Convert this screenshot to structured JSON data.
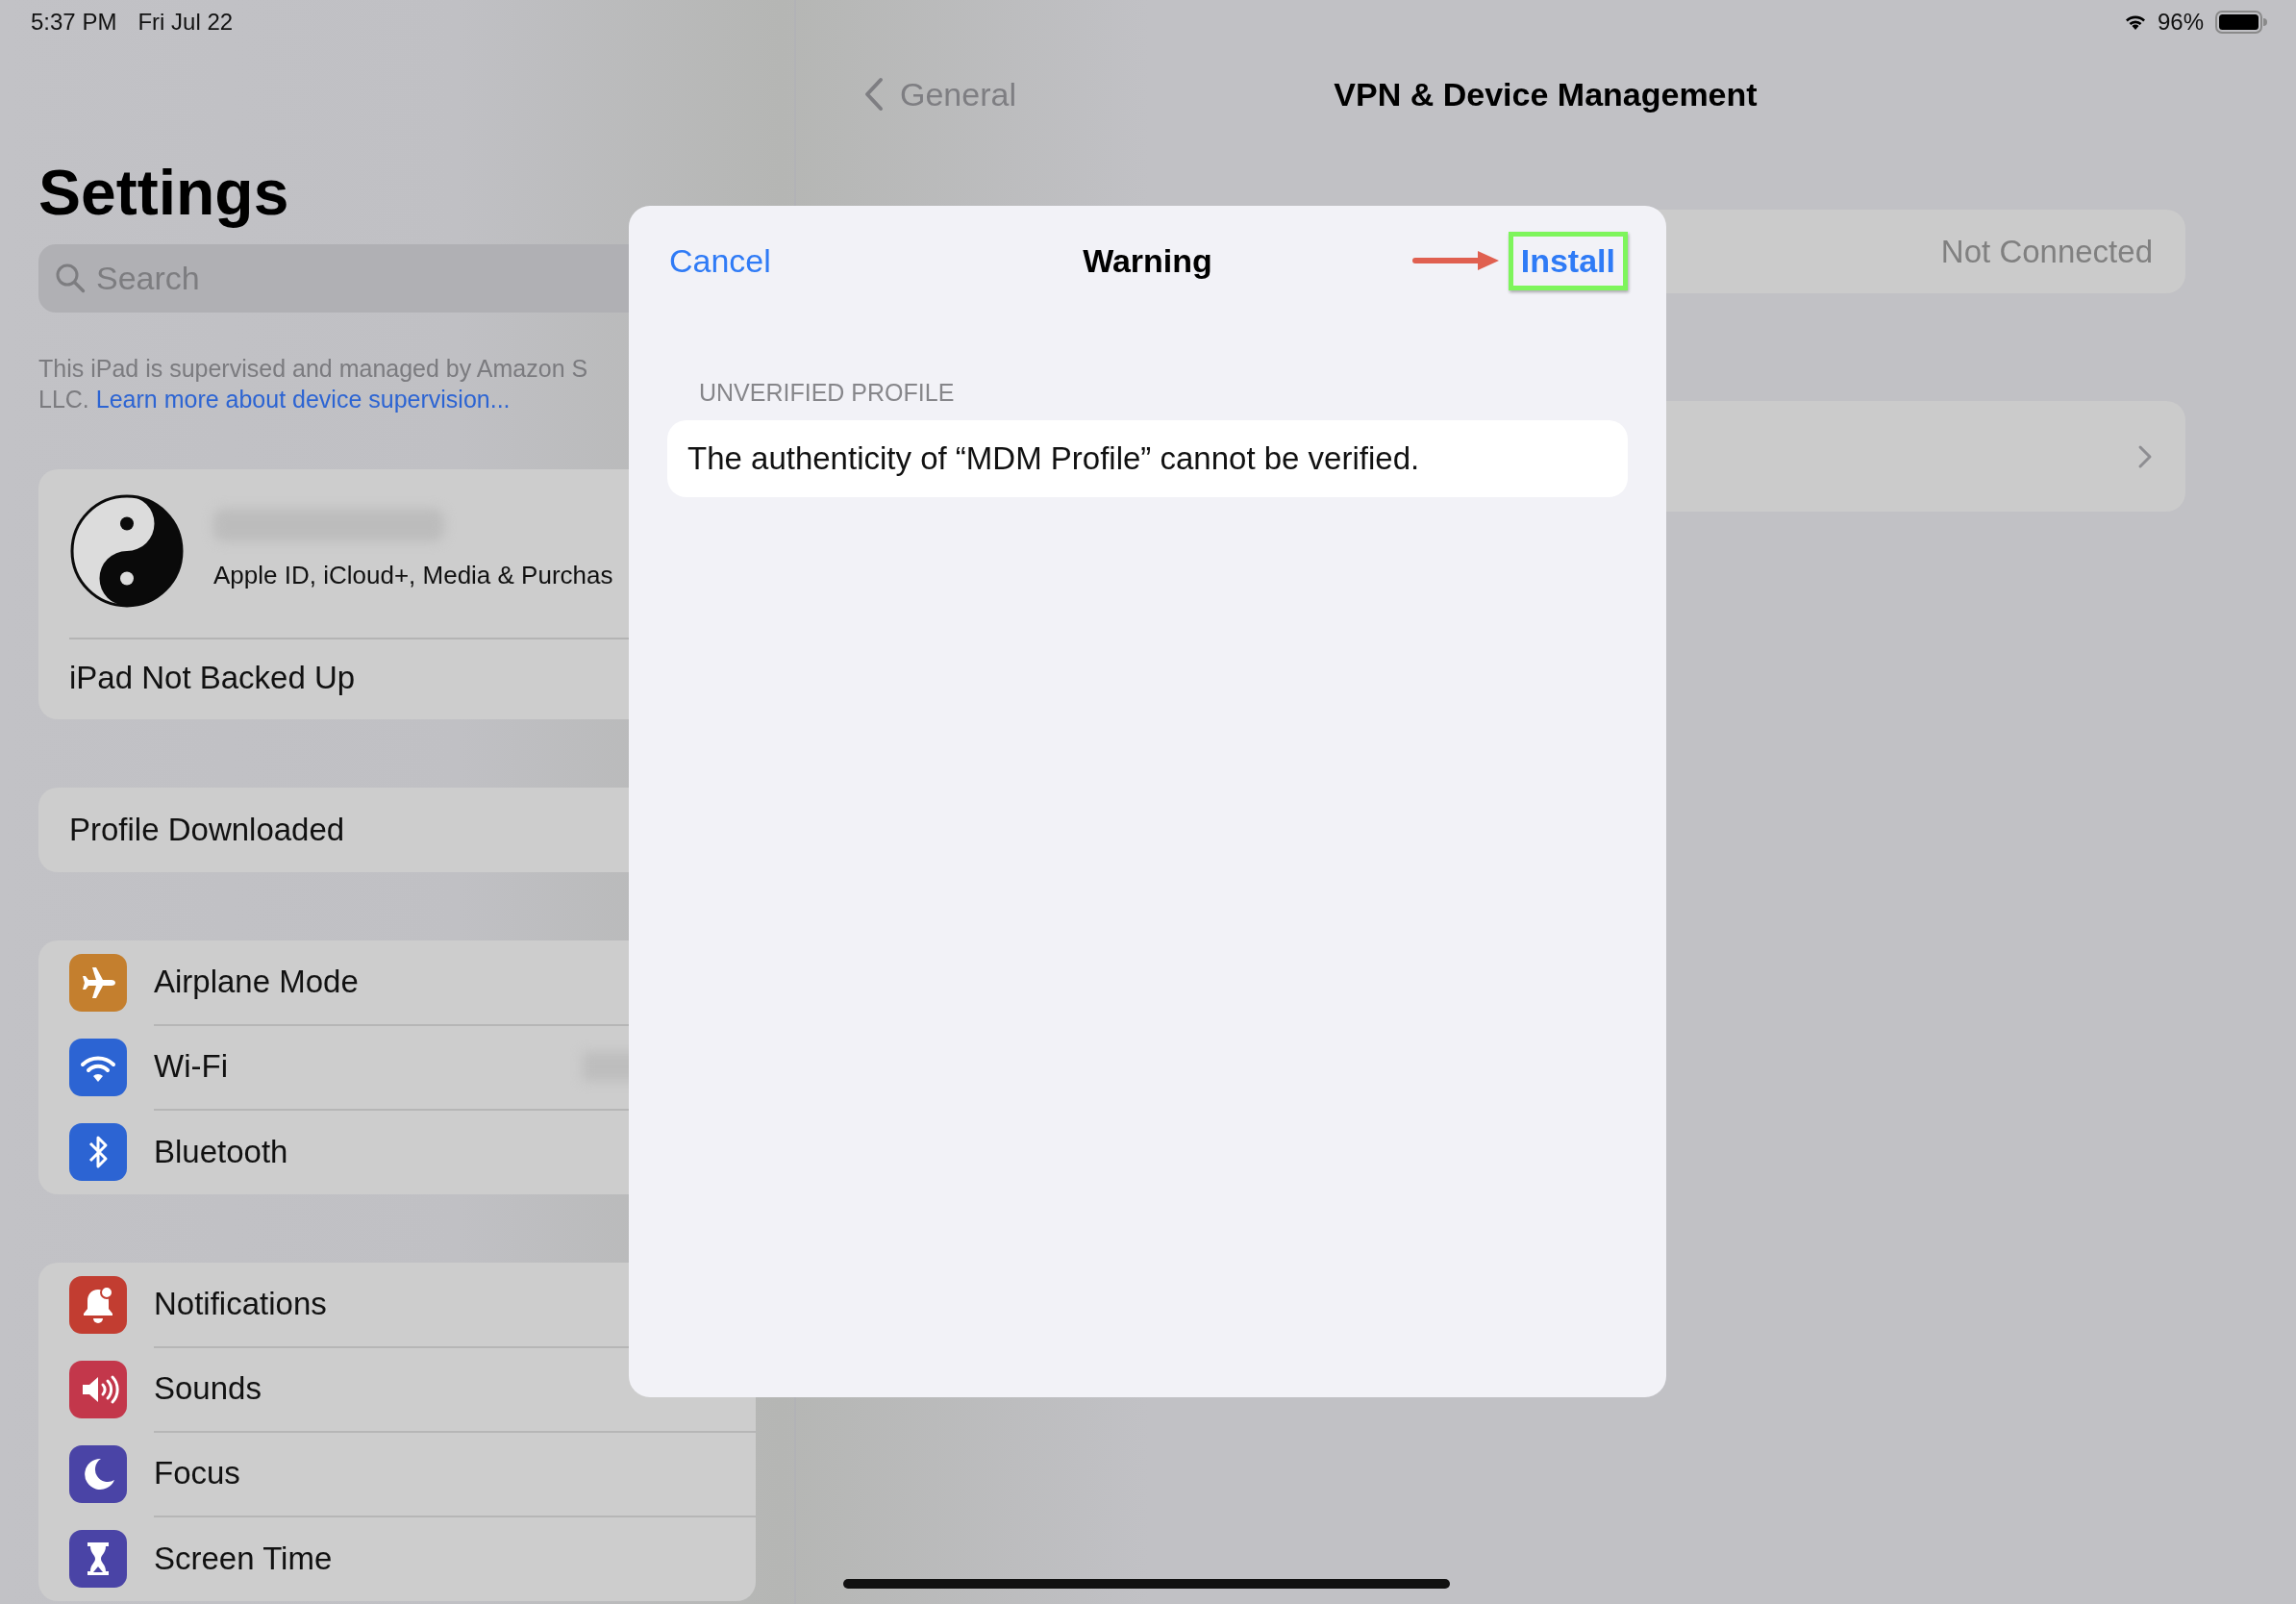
{
  "status_bar": {
    "time": "5:37 PM",
    "date": "Fri Jul 22",
    "battery": "96%"
  },
  "sidebar": {
    "title": "Settings",
    "search": {
      "placeholder": "Search"
    },
    "supervision_note": {
      "line_1": "This iPad is supervised and managed by Amazon S",
      "line_2": "LLC.",
      "link": "Learn more about device supervision..."
    },
    "account": {
      "name_redacted": true,
      "subtitle": "Apple ID, iCloud+, Media & Purchas",
      "backup_status": "iPad Not Backed Up"
    },
    "groups": [
      {
        "items": [
          {
            "label": "Profile Downloaded"
          }
        ]
      },
      {
        "items": [
          {
            "label": "Airplane Mode",
            "color": "#c47f2e"
          },
          {
            "label": "Wi-Fi",
            "color": "#2c64d3",
            "detail_redacted": true
          },
          {
            "label": "Bluetooth",
            "color": "#2c64d3"
          }
        ]
      },
      {
        "items": [
          {
            "label": "Notifications",
            "color": "#c23d31"
          },
          {
            "label": "Sounds",
            "color": "#c3374b"
          },
          {
            "label": "Focus",
            "color": "#4a44a6"
          },
          {
            "label": "Screen Time",
            "color": "#4a44a6"
          }
        ]
      }
    ]
  },
  "detail": {
    "back": "General",
    "title": "VPN & Device Management",
    "rows": [
      {
        "value": "Not Connected",
        "chevron": false
      },
      {
        "chevron": true
      }
    ]
  },
  "dialog": {
    "cancel": "Cancel",
    "title": "Warning",
    "confirm": "Install",
    "confirm_highlighted": true,
    "section_header": "UNVERIFIED PROFILE",
    "message": "The authenticity of “MDM Profile” cannot be verified."
  }
}
